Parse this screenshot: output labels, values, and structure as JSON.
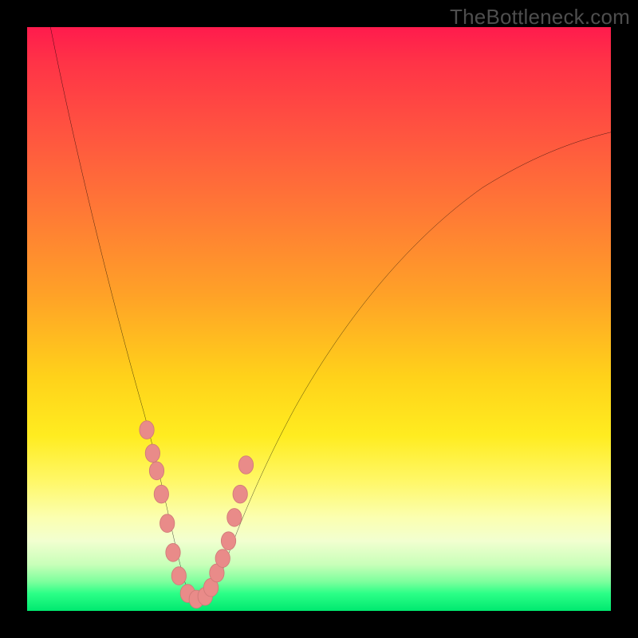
{
  "watermark": "TheBottleneck.com",
  "colors": {
    "frame": "#000000",
    "curve": "#000000",
    "marker_fill": "#e98b89",
    "marker_stroke": "#d07a78",
    "gradient_stops": [
      "#ff1b4d",
      "#ff7a35",
      "#ffd21a",
      "#fbffb0",
      "#00e96f"
    ]
  },
  "chart_data": {
    "type": "line",
    "title": "",
    "xlabel": "",
    "ylabel": "",
    "xlim": [
      0,
      100
    ],
    "ylim": [
      0,
      100
    ],
    "note": "Axes are unlabeled in the source image; x/y read as 0–100% of plot width/height. y=0 is the bottom (green) edge.",
    "series": [
      {
        "name": "curve",
        "x": [
          4,
          6,
          8,
          10,
          12,
          14,
          16,
          18,
          20,
          22,
          24,
          25,
          27,
          29,
          31,
          33,
          36,
          40,
          45,
          50,
          55,
          60,
          65,
          70,
          75,
          80,
          85,
          90,
          95,
          100
        ],
        "y": [
          100,
          90,
          80,
          72,
          64,
          56,
          49,
          42,
          35,
          28,
          20,
          12,
          5,
          2,
          2,
          4,
          8,
          16,
          27,
          38,
          48,
          56,
          63,
          68,
          72,
          75,
          77.5,
          79.5,
          81,
          82
        ]
      }
    ],
    "markers": {
      "name": "highlighted-points",
      "x": [
        20.5,
        21.5,
        22.2,
        23.0,
        24.0,
        25.0,
        26.0,
        27.5,
        29.0,
        30.5,
        31.5,
        32.5,
        33.5,
        34.5,
        35.5,
        36.5,
        37.5
      ],
      "y": [
        31,
        27,
        24,
        20,
        15,
        10,
        6,
        3,
        2,
        2.5,
        4,
        6.5,
        9,
        12,
        16,
        20,
        25
      ]
    }
  }
}
